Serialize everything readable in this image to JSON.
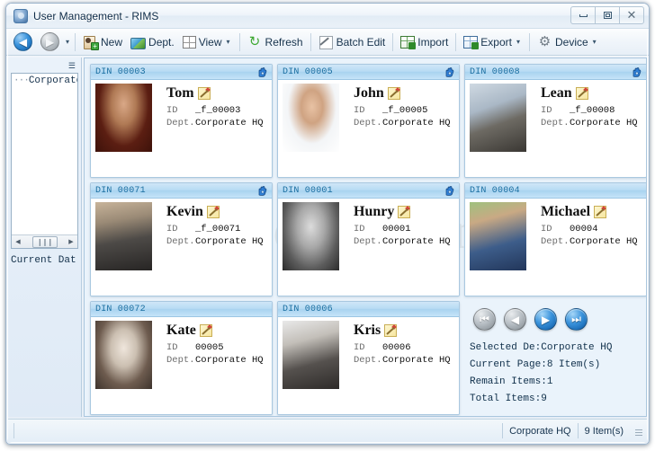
{
  "window": {
    "title": "User Management - RIMS",
    "app_icon": "app-shield-icon",
    "minimize_label": "–",
    "maximize_label": "□",
    "close_label": "✕"
  },
  "toolbar": {
    "back_glyph": "◀",
    "forward_glyph": "▶",
    "history_caret": "▾",
    "items": [
      {
        "label": "New",
        "icon": "new-user-icon",
        "caret": ""
      },
      {
        "label": "Dept.",
        "icon": "department-icon",
        "caret": ""
      },
      {
        "label": "View",
        "icon": "view-grid-icon",
        "caret": "▾"
      },
      {
        "label": "Refresh",
        "icon": "refresh-icon",
        "caret": ""
      },
      {
        "label": "Batch Edit",
        "icon": "batch-edit-icon",
        "caret": ""
      },
      {
        "label": "Import",
        "icon": "import-icon",
        "caret": ""
      },
      {
        "label": "Export",
        "icon": "export-icon",
        "caret": "▾"
      },
      {
        "label": "Device",
        "icon": "device-gear-icon",
        "caret": "▾"
      }
    ]
  },
  "sidebar": {
    "collapse_glyph": "☰",
    "tree": {
      "prefix_dots": "···",
      "root_label": "Corporate"
    },
    "hscroll": {
      "left_glyph": "◀",
      "thumb_glyph": "❙❙❙",
      "right_glyph": "▶"
    },
    "current_data_label": "Current Dat"
  },
  "cards": [
    {
      "din": "DIN 00003",
      "name": "Tom",
      "id_key": "ID",
      "id_value": "_f_00003",
      "dept_key": "Dept.",
      "dept_value": "Corporate HQ",
      "has_hand": true,
      "photo": "portrait-young-man-dark-red-bg"
    },
    {
      "din": "DIN 00005",
      "name": "John",
      "id_key": "ID",
      "id_value": "_f_00005",
      "dept_key": "Dept.",
      "dept_value": "Corporate HQ",
      "has_hand": true,
      "photo": "portrait-woman-glasses-white-bg"
    },
    {
      "din": "DIN 00008",
      "name": "Lean",
      "id_key": "ID",
      "id_value": "_f_00008",
      "dept_key": "Dept.",
      "dept_value": "Corporate HQ",
      "has_hand": true,
      "photo": "portrait-businessman-desk"
    },
    {
      "din": "DIN 00071",
      "name": "Kevin",
      "id_key": "ID",
      "id_value": "_f_00071",
      "dept_key": "Dept.",
      "dept_value": "Corporate HQ",
      "has_hand": true,
      "photo": "portrait-man-outdoors-street"
    },
    {
      "din": "DIN 00001",
      "name": "Hunry",
      "id_key": "ID",
      "id_value": "00001",
      "dept_key": "Dept.",
      "dept_value": "Corporate HQ",
      "has_hand": true,
      "photo": "portrait-man-grayscale"
    },
    {
      "din": "DIN 00004",
      "name": "Michael",
      "id_key": "ID",
      "id_value": "00004",
      "dept_key": "Dept.",
      "dept_value": "Corporate HQ",
      "has_hand": false,
      "photo": "portrait-man-blue-suit-outdoors"
    },
    {
      "din": "DIN 00072",
      "name": "Kate",
      "id_key": "ID",
      "id_value": "00005",
      "dept_key": "Dept.",
      "dept_value": "Corporate HQ",
      "has_hand": false,
      "photo": "portrait-woman-hands-up"
    },
    {
      "din": "DIN 00006",
      "name": "Kris",
      "id_key": "ID",
      "id_value": "00006",
      "dept_key": "Dept.",
      "dept_value": "Corporate HQ",
      "has_hand": false,
      "photo": "portrait-man-vest-hand-on-face"
    }
  ],
  "pager": {
    "first_glyph": "⏮",
    "prev_glyph": "◀",
    "next_glyph": "▶",
    "last_glyph": "⏭",
    "first_enabled": false,
    "prev_enabled": false,
    "next_enabled": true,
    "last_enabled": true
  },
  "info": [
    {
      "key": "Selected De:",
      "value": "Corporate HQ"
    },
    {
      "key": "Current Page: ",
      "value": "8 Item(s)"
    },
    {
      "key": "Remain Items: ",
      "value": "1"
    },
    {
      "key": "Total Items: ",
      "value": "9"
    }
  ],
  "statusbar": {
    "dept": "Corporate HQ",
    "count": "9 Item(s)"
  },
  "watermark": {
    "big": "Dreamstime",
    "small": "www.dreamstime.com"
  },
  "colors": {
    "accent": "#1a6ea0",
    "card_header_top": "#cfe6f7",
    "card_header_bottom": "#a9d3f0",
    "panel_bg": "#eaf3fb",
    "window_bg": "#e6eef6"
  }
}
